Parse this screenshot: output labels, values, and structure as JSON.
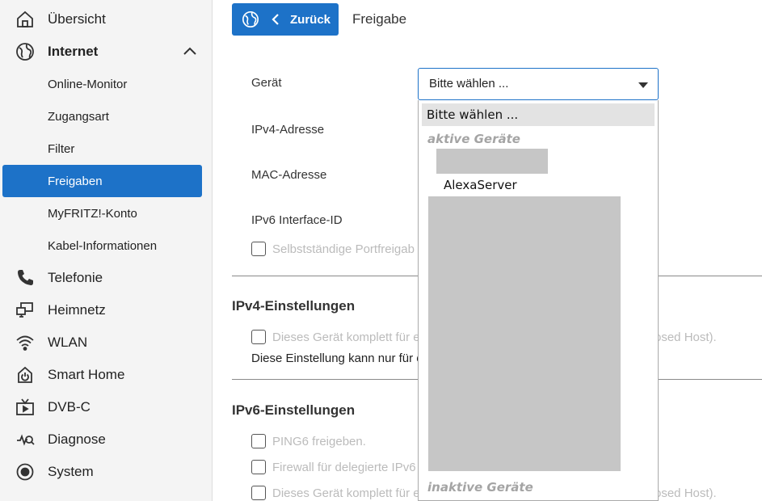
{
  "sidebar": {
    "items": [
      {
        "label": "Übersicht",
        "icon": "home-icon"
      },
      {
        "label": "Internet",
        "icon": "globe-icon"
      },
      {
        "label": "Telefonie",
        "icon": "phone-icon"
      },
      {
        "label": "Heimnetz",
        "icon": "network-icon"
      },
      {
        "label": "WLAN",
        "icon": "wifi-icon"
      },
      {
        "label": "Smart Home",
        "icon": "power-icon"
      },
      {
        "label": "DVB-C",
        "icon": "tv-icon"
      },
      {
        "label": "Diagnose",
        "icon": "diagnose-icon"
      },
      {
        "label": "System",
        "icon": "system-icon"
      }
    ],
    "internet_sub": [
      {
        "label": "Online-Monitor"
      },
      {
        "label": "Zugangsart"
      },
      {
        "label": "Filter"
      },
      {
        "label": "Freigaben"
      },
      {
        "label": "MyFRITZ!-Konto"
      },
      {
        "label": "Kabel-Informationen"
      }
    ]
  },
  "header": {
    "back_label": "Zurück",
    "title": "Freigabe"
  },
  "form": {
    "geraet_label": "Gerät",
    "select_value": "Bitte wählen ...",
    "ipv4_label": "IPv4-Adresse",
    "mac_label": "MAC-Adresse",
    "ipv6_label": "IPv6 Interface-ID",
    "auto_port_text": "Selbstständige Portfreigab"
  },
  "ipv4_section": {
    "title": "IPv4-Einstellungen",
    "exposed_text_left": "Dieses Gerät komplett für e",
    "exposed_text_right": "osed Host).",
    "note_text": "Diese Einstellung kann nur für e"
  },
  "ipv6_section": {
    "title": "IPv6-Einstellungen",
    "ping6_text": "PING6 freigeben.",
    "firewall_text": "Firewall für delegierte IPv6",
    "exposed_text_left": "Dieses Gerät komplett für e",
    "exposed_text_right": "osed Host)."
  },
  "dropdown": {
    "selected_option": "Bitte wählen ...",
    "group_active": "aktive Geräte",
    "option_alexa": "AlexaServer",
    "group_inactive": "inaktive Geräte"
  },
  "colors": {
    "accent": "#1d72c8",
    "sidebar_bg": "#f4f4f4",
    "disabled_text": "#bbbbbb",
    "redacted": "#c6c6c6"
  }
}
